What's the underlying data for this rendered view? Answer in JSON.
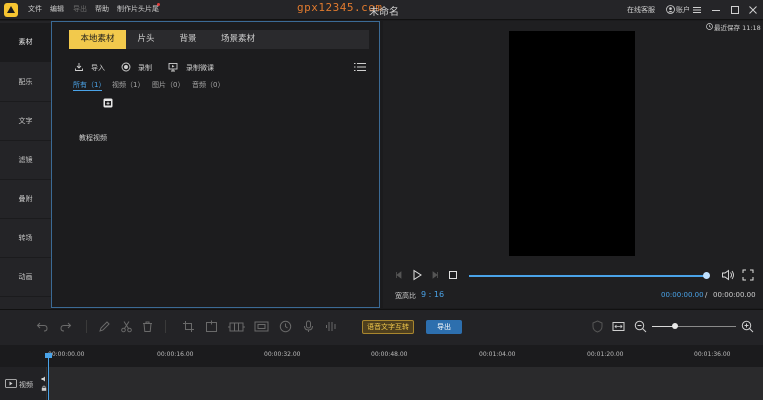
{
  "titlebar": {
    "menu": [
      {
        "label": "文件",
        "enabled": true
      },
      {
        "label": "编辑",
        "enabled": true
      },
      {
        "label": "导出",
        "enabled": false
      },
      {
        "label": "帮助",
        "enabled": true
      },
      {
        "label": "制作片头片尾",
        "enabled": true
      }
    ],
    "watermark": "gpx12345.com",
    "doc_title": "未命名",
    "help_link": "在线客服",
    "user_label": "账户"
  },
  "left_tabs": [
    {
      "label": "素材",
      "active": true
    },
    {
      "label": "配乐",
      "active": false
    },
    {
      "label": "文字",
      "active": false
    },
    {
      "label": "滤镜",
      "active": false
    },
    {
      "label": "叠附",
      "active": false
    },
    {
      "label": "转场",
      "active": false
    },
    {
      "label": "动画",
      "active": false
    }
  ],
  "media": {
    "tabs": [
      {
        "label": "本地素材",
        "active": true
      },
      {
        "label": "片头",
        "active": false
      },
      {
        "label": "背景",
        "active": false
      },
      {
        "label": "场景素材",
        "active": false
      }
    ],
    "tools": {
      "import": "导入",
      "record": "录制",
      "record_screen": "录制微课"
    },
    "filters": [
      {
        "label": "所有（1）",
        "active": true
      },
      {
        "label": "视频（1）",
        "active": false
      },
      {
        "label": "图片（0）",
        "active": false
      },
      {
        "label": "音频（0）",
        "active": false
      }
    ],
    "folder_title": "教程视频"
  },
  "preview": {
    "recent_save": "最近保存 11:18",
    "aspect_label": "宽高比",
    "aspect_value": "9 : 16",
    "time_current": "00:00:00.00",
    "time_separator": "/",
    "time_total": "00:00:00.00",
    "progress_fraction": 1.0
  },
  "toolbar": {
    "tts_label": "语音文字互转",
    "export_label": "导出",
    "zoom_fraction": 0.27
  },
  "timeline": {
    "ticks": [
      "00:00:00.00",
      "00:00:16.00",
      "00:00:32.00",
      "00:00:48.00",
      "00:01:04.00",
      "00:01:20.00",
      "00:01:36.00"
    ],
    "track_label": "视频"
  },
  "colors": {
    "accent": "#4aa3e8",
    "highlight": "#f2c94c",
    "logo": "#f7c531",
    "watermark": "#e07a2e"
  }
}
